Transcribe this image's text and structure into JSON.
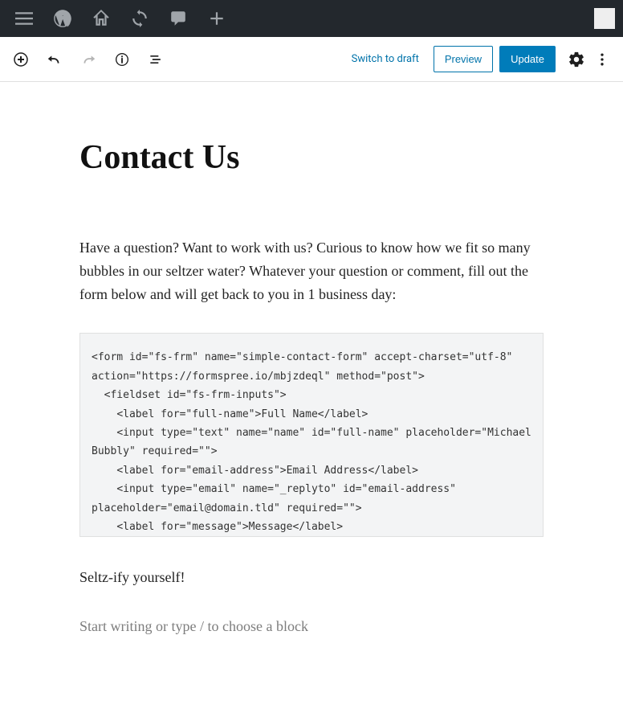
{
  "toolbar": {
    "switch_draft": "Switch to draft",
    "preview": "Preview",
    "update": "Update"
  },
  "content": {
    "title": "Contact Us",
    "intro": "Have a question? Want to work with us? Curious to know how we fit so many bubbles in our seltzer water? Whatever your question or comment, fill out the form below and will get back to you in 1 business day:",
    "code": "<form id=\"fs-frm\" name=\"simple-contact-form\" accept-charset=\"utf-8\" action=\"https://formspree.io/mbjzdeql\" method=\"post\">\n  <fieldset id=\"fs-frm-inputs\">\n    <label for=\"full-name\">Full Name</label>\n    <input type=\"text\" name=\"name\" id=\"full-name\" placeholder=\"Michael Bubbly\" required=\"\">\n    <label for=\"email-address\">Email Address</label>\n    <input type=\"email\" name=\"_replyto\" id=\"email-address\" placeholder=\"email@domain.tld\" required=\"\">\n    <label for=\"message\">Message</label>",
    "seltz": "Seltz-ify yourself!",
    "placeholder": "Start writing or type / to choose a block"
  }
}
